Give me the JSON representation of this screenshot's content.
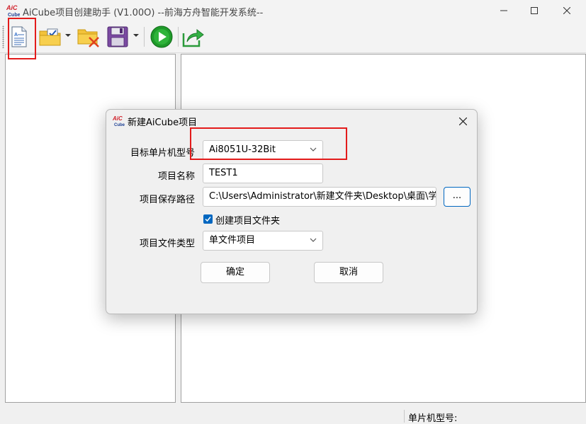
{
  "window": {
    "title": "AiCube项目创建助手 (V1.00O) --前海方舟智能开发系统--",
    "logo_text_top": "AiC",
    "logo_text_bottom": "Cube"
  },
  "toolbar": {
    "buttons": [
      {
        "name": "new-project",
        "icon": "document-icon"
      },
      {
        "name": "open-project",
        "icon": "folder-check-icon",
        "has_dropdown": true
      },
      {
        "name": "close-project",
        "icon": "folder-delete-icon"
      },
      {
        "name": "save-project",
        "icon": "save-disk-icon",
        "has_dropdown": true
      },
      {
        "name": "run",
        "icon": "play-icon"
      },
      {
        "name": "export",
        "icon": "export-arrow-icon"
      }
    ]
  },
  "statusbar": {
    "mcu_label": "单片机型号:"
  },
  "dialog": {
    "title": "新建AiCube项目",
    "mcu_model_label": "目标单片机型号",
    "mcu_model_value": "Ai8051U-32Bit",
    "project_name_label": "项目名称",
    "project_name_value": "TEST1",
    "save_path_label": "项目保存路径",
    "save_path_value": "C:\\Users\\Administrator\\新建文件夹\\Desktop\\桌面\\学习",
    "browse_label": "...",
    "create_folder_label": "创建项目文件夹",
    "create_folder_checked": true,
    "file_type_label": "项目文件类型",
    "file_type_value": "单文件项目",
    "ok_label": "确定",
    "cancel_label": "取消"
  },
  "colors": {
    "highlight": "#e31b1b",
    "accent": "#0067c0",
    "run_green": "#1f9a2a"
  }
}
